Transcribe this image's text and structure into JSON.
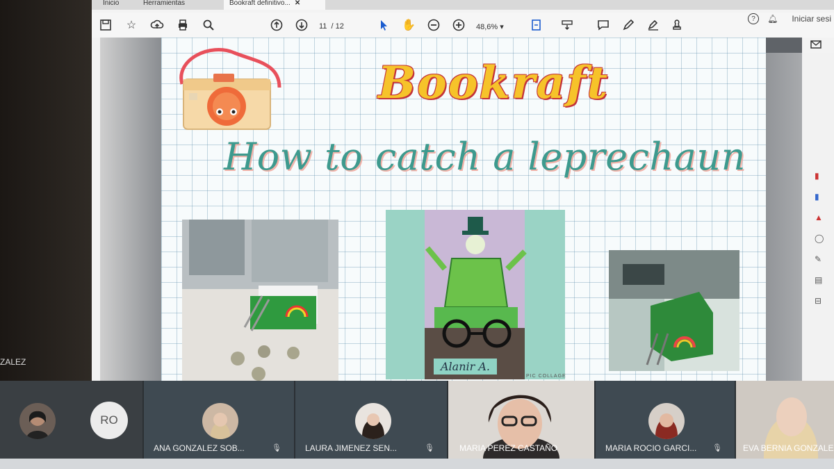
{
  "window": {
    "tabs": [
      {
        "label": "Inicio"
      },
      {
        "label": "Herramientas"
      },
      {
        "label": "Bookraft definitivo..."
      }
    ],
    "signin_label": "Iniciar sesi"
  },
  "toolbar": {
    "page_current": "11",
    "page_total": "/ 12",
    "zoom": "48,6%"
  },
  "slide": {
    "brand": "Bookraft",
    "subtitle": "How to catch a leprechaun",
    "caption": "Alanir A.",
    "credit": "PIC COLLAGE"
  },
  "left_fragment": "ZALEZ",
  "participants": [
    {
      "initials": "",
      "name": ""
    },
    {
      "initials": "RO",
      "name": ""
    },
    {
      "name": "ANA GONZALEZ SOB..."
    },
    {
      "name": "LAURA JIMENEZ SEN..."
    },
    {
      "name": "MARIA PEREZ CASTAÑO"
    },
    {
      "name": "MARIA ROCIO GARCI..."
    },
    {
      "name": "EVA BERNIA GONZALEZ"
    }
  ],
  "colors": {
    "brand_fill": "#f6c32a",
    "brand_outline": "#c3333a",
    "subtitle": "#3d9a8e",
    "caption_bg": "#8fd3c4"
  }
}
